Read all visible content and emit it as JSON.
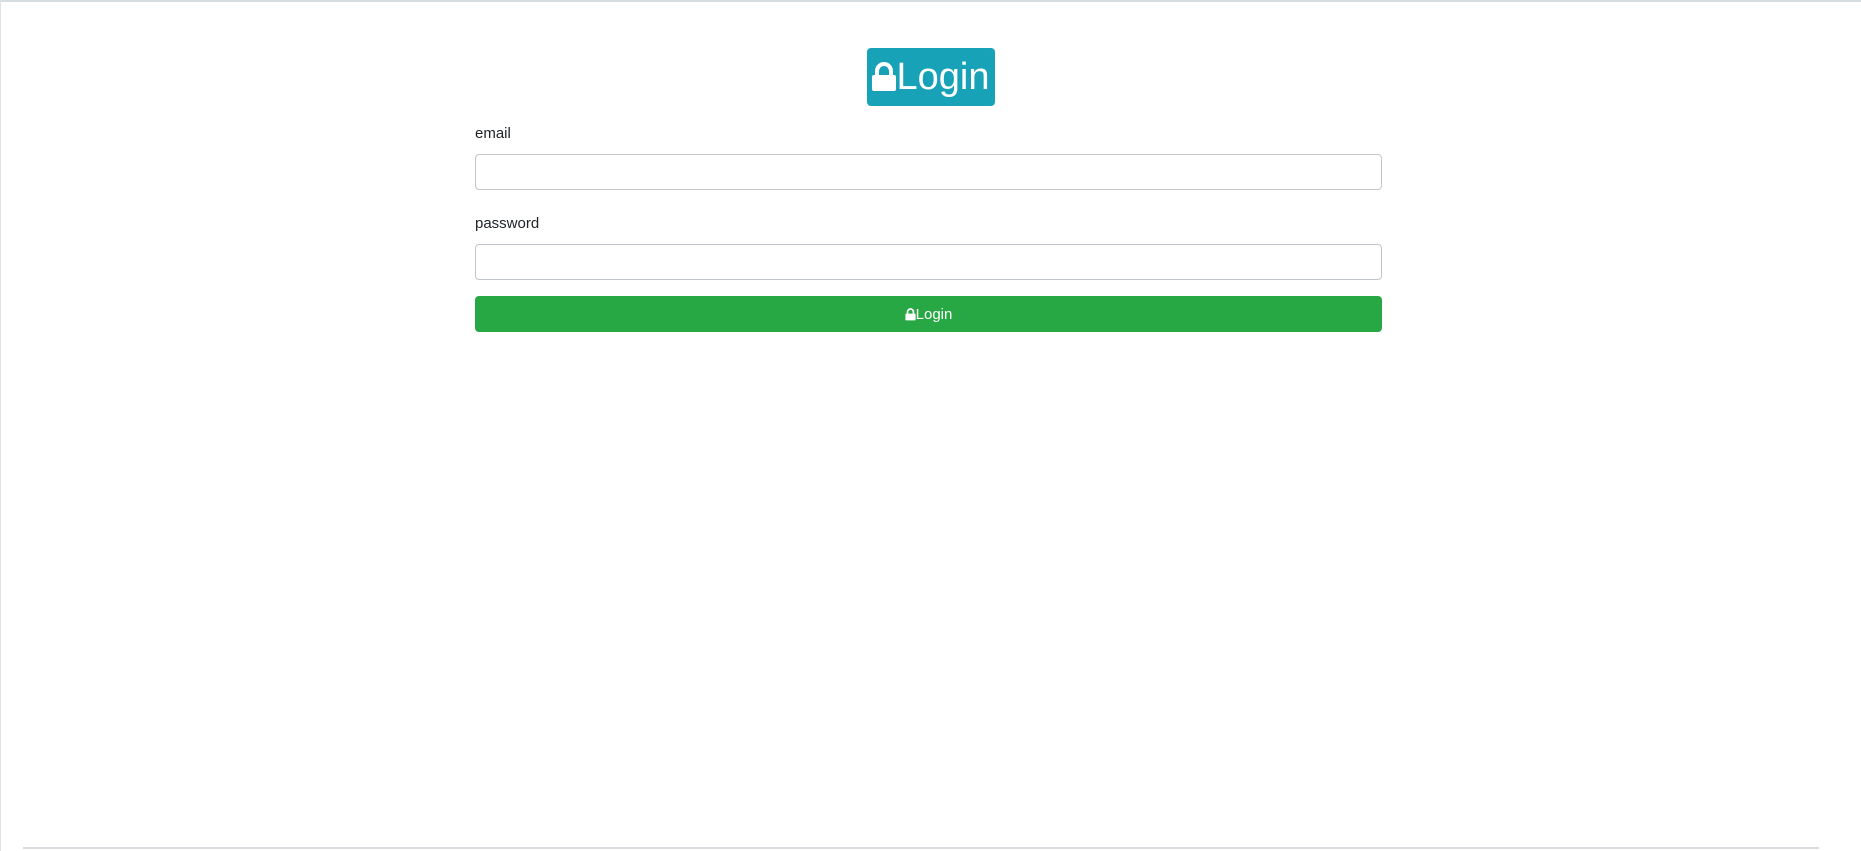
{
  "header": {
    "icon": "lock-icon",
    "title": "Login"
  },
  "form": {
    "email": {
      "label": "email",
      "value": "",
      "placeholder": ""
    },
    "password": {
      "label": "password",
      "value": "",
      "placeholder": ""
    },
    "submit": {
      "icon": "lock-icon",
      "label": "Login"
    }
  },
  "colors": {
    "heading_bg": "#17a2b8",
    "submit_bg": "#28a745",
    "text": "#212529"
  }
}
